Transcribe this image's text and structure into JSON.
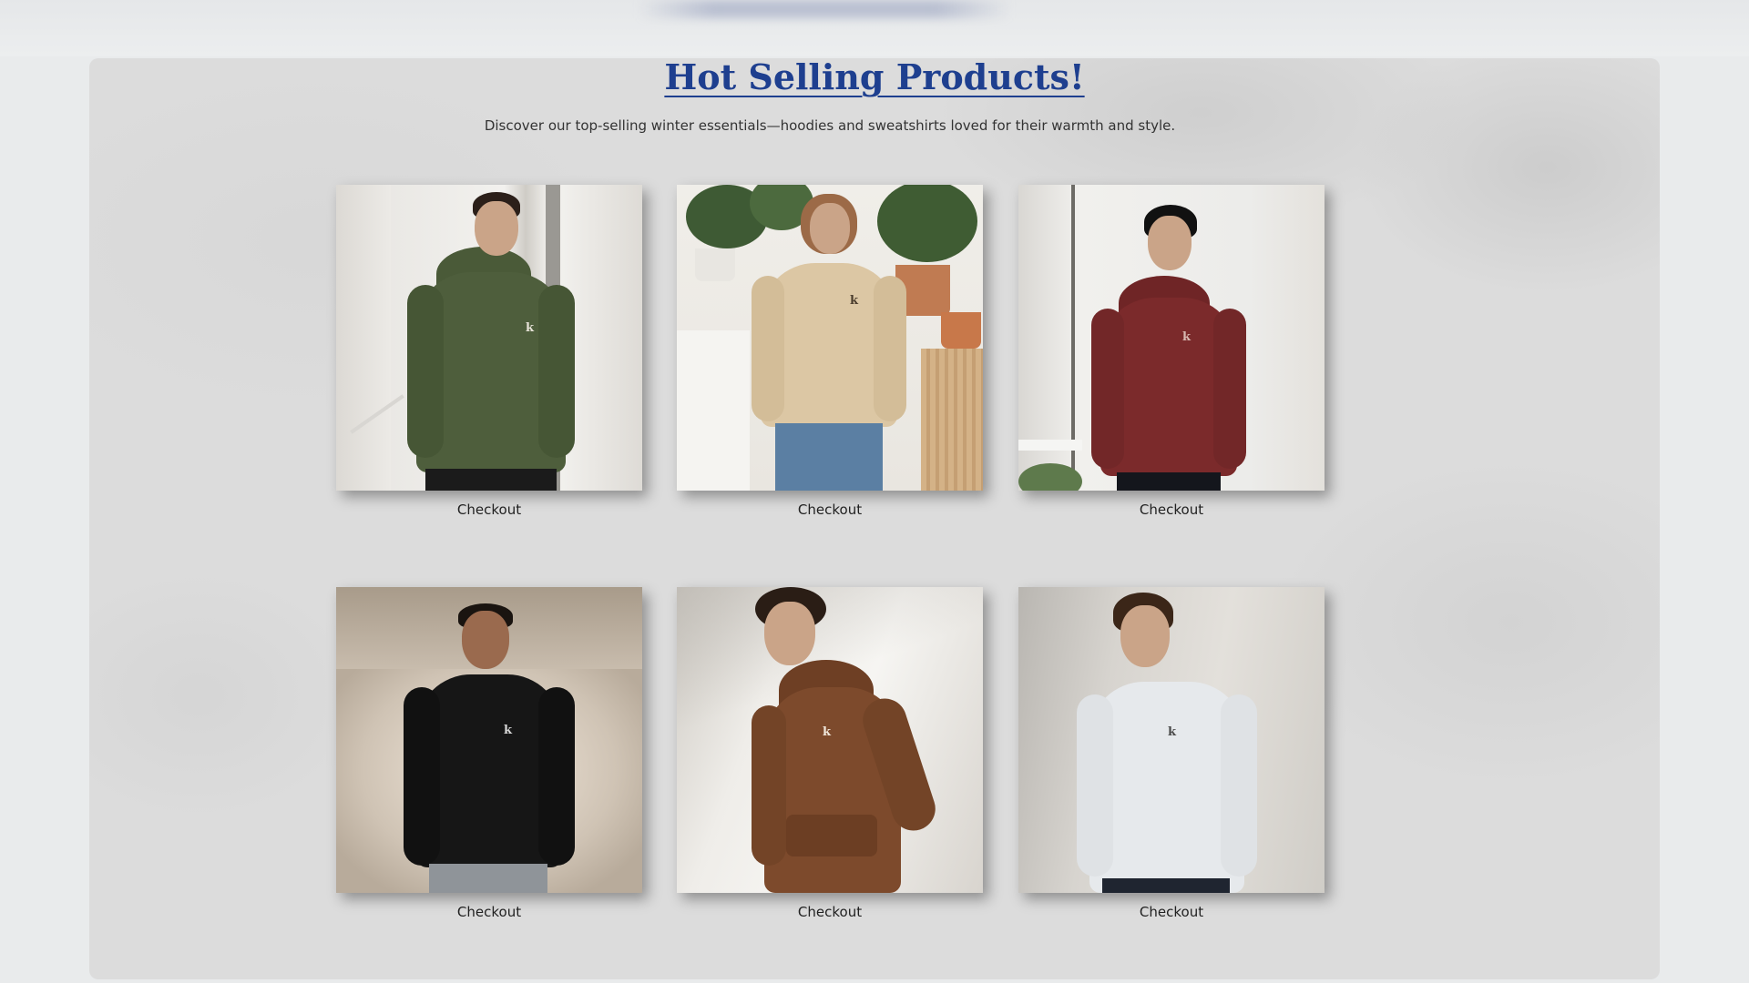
{
  "section": {
    "title": "Hot Selling Products!",
    "subtitle": "Discover our top-selling winter essentials—hoodies and sweatshirts loved for their warmth and style."
  },
  "products": [
    {
      "caption": "Checkout",
      "garment": "green hoodie",
      "color": "#4e5e3c",
      "logo": "k"
    },
    {
      "caption": "Checkout",
      "garment": "beige sweatshirt",
      "color": "#dcc7a4",
      "logo": "k"
    },
    {
      "caption": "Checkout",
      "garment": "maroon hoodie",
      "color": "#7b2a2b",
      "logo": "k"
    },
    {
      "caption": "Checkout",
      "garment": "black sweatshirt",
      "color": "#161616",
      "logo": "k"
    },
    {
      "caption": "Checkout",
      "garment": "brown hoodie",
      "color": "#7d4a2c",
      "logo": "k"
    },
    {
      "caption": "Checkout",
      "garment": "white sweatshirt",
      "color": "#e6e9ec",
      "logo": "k"
    }
  ],
  "colors": {
    "title": "#1e3f8f",
    "background": "#dcdcdc"
  }
}
